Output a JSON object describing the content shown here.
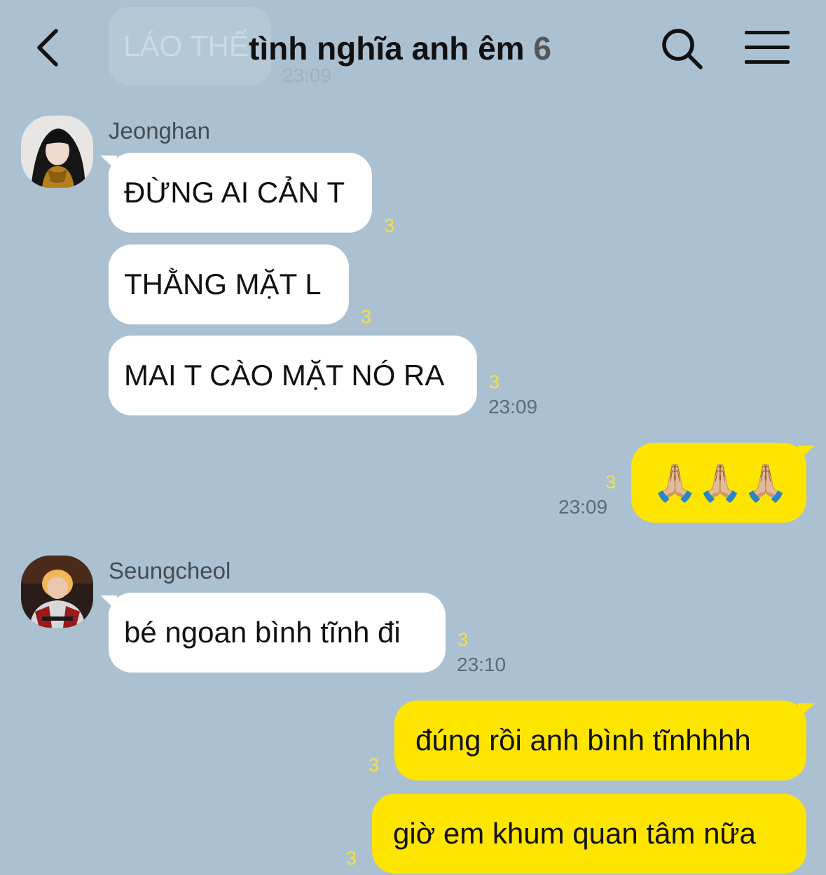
{
  "header": {
    "back_icon": "chevron-left-icon",
    "title": "tình nghĩa anh êm",
    "member_count": "6",
    "search_icon": "search-icon",
    "menu_icon": "hamburger-menu-icon"
  },
  "ghost": {
    "text": "LÁO THẾ",
    "time": "23:09"
  },
  "messages": {
    "m1": {
      "sender": "Jeonghan",
      "text": "ĐỪNG AI CẢN T",
      "unread": "3"
    },
    "m2": {
      "text": "THẰNG MẶT L",
      "unread": "3"
    },
    "m3": {
      "text": "MAI T CÀO MẶT NÓ RA",
      "unread": "3",
      "time": "23:09"
    },
    "m4": {
      "text": "🙏🏼🙏🏼🙏🏼",
      "unread": "3",
      "time": "23:09"
    },
    "m5": {
      "sender": "Seungcheol",
      "text": "bé ngoan bình tĩnh đi",
      "unread": "3",
      "time": "23:10"
    },
    "m6": {
      "text": "đúng rồi anh bình tĩnhhhh",
      "unread": "3"
    },
    "m7": {
      "text": "giờ em khum quan tâm nữa",
      "unread": "3"
    }
  },
  "colors": {
    "background": "#abc1d1",
    "incoming_bubble": "#ffffff",
    "outgoing_bubble": "#fee500",
    "unread_count": "#f6e23a"
  }
}
